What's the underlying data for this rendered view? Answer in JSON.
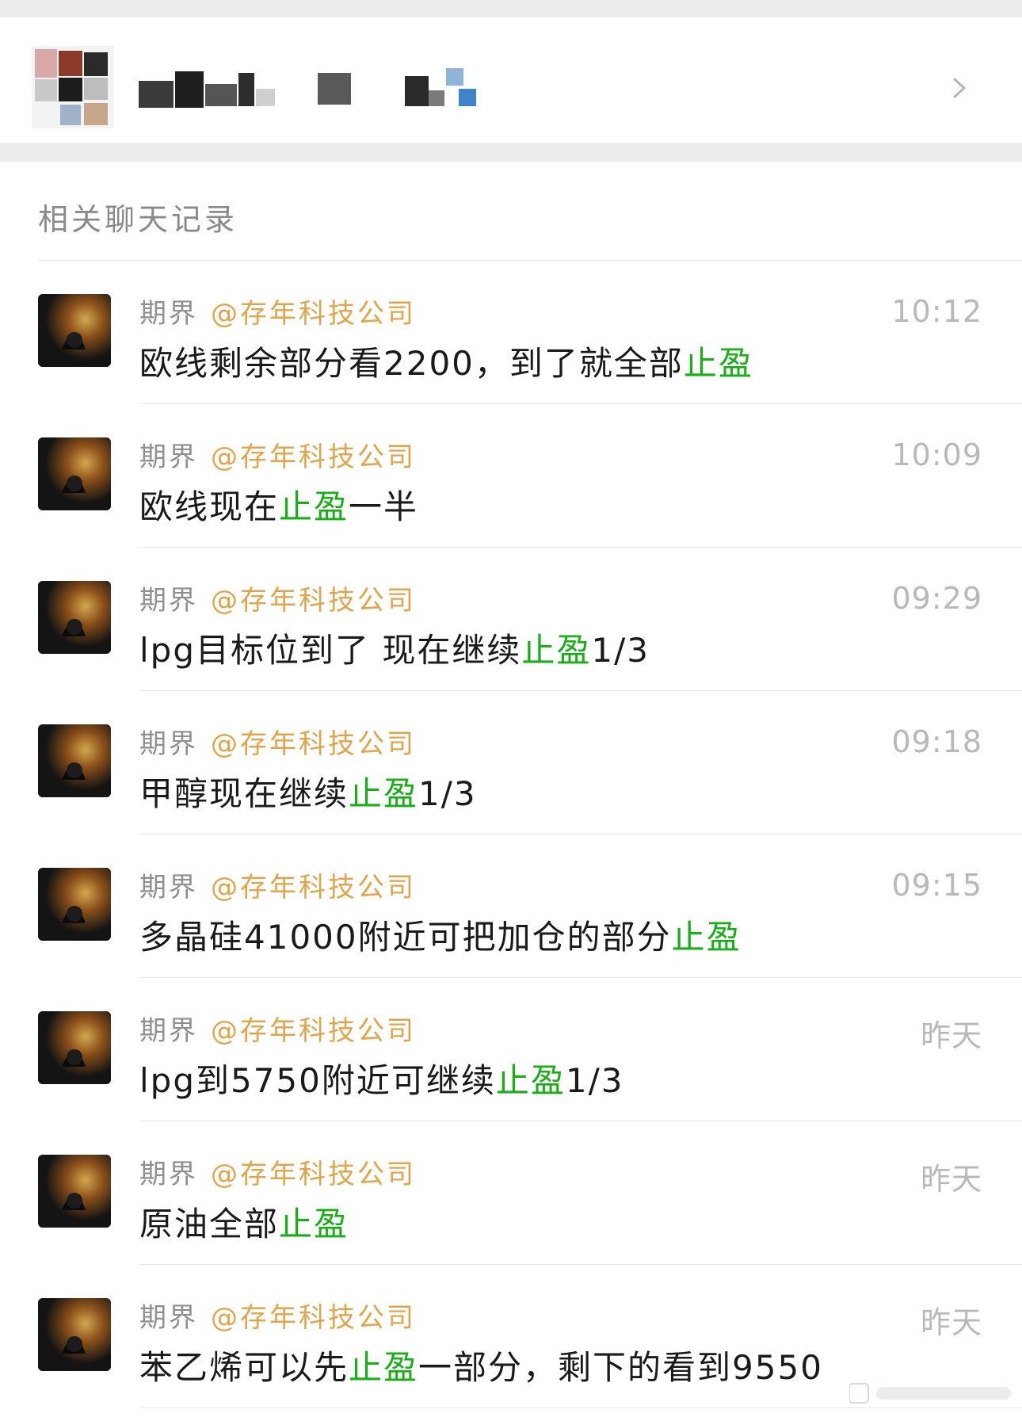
{
  "header": {
    "section_title": "相关聊天记录"
  },
  "icons": {
    "group_avatar": "group-avatar-image",
    "chevron": "chevron-right-icon",
    "user_avatar": "user-avatar-image"
  },
  "colors": {
    "highlight": "#1aad19",
    "mention": "#e0a54c",
    "muted": "#8f8f8f"
  },
  "messages": [
    {
      "sender": "期界",
      "mention": "@存年科技公司",
      "time": "10:12",
      "parts": [
        "欧线剩余部分看2200，到了就全部",
        "止盈",
        ""
      ]
    },
    {
      "sender": "期界",
      "mention": "@存年科技公司",
      "time": "10:09",
      "parts": [
        "欧线现在",
        "止盈",
        "一半"
      ]
    },
    {
      "sender": "期界",
      "mention": "@存年科技公司",
      "time": "09:29",
      "parts": [
        "lpg目标位到了 现在继续",
        "止盈",
        "1/3"
      ]
    },
    {
      "sender": "期界",
      "mention": "@存年科技公司",
      "time": "09:18",
      "parts": [
        "甲醇现在继续",
        "止盈",
        "1/3"
      ]
    },
    {
      "sender": "期界",
      "mention": "@存年科技公司",
      "time": "09:15",
      "parts": [
        "多晶硅41000附近可把加仓的部分",
        "止盈",
        ""
      ]
    },
    {
      "sender": "期界",
      "mention": "@存年科技公司",
      "time": "昨天",
      "parts": [
        "lpg到5750附近可继续",
        "止盈",
        "1/3"
      ]
    },
    {
      "sender": "期界",
      "mention": "@存年科技公司",
      "time": "昨天",
      "parts": [
        "原油全部",
        "止盈",
        ""
      ]
    },
    {
      "sender": "期界",
      "mention": "@存年科技公司",
      "time": "昨天",
      "parts": [
        "苯乙烯可以先",
        "止盈",
        "一部分，剩下的看到9550"
      ]
    }
  ]
}
